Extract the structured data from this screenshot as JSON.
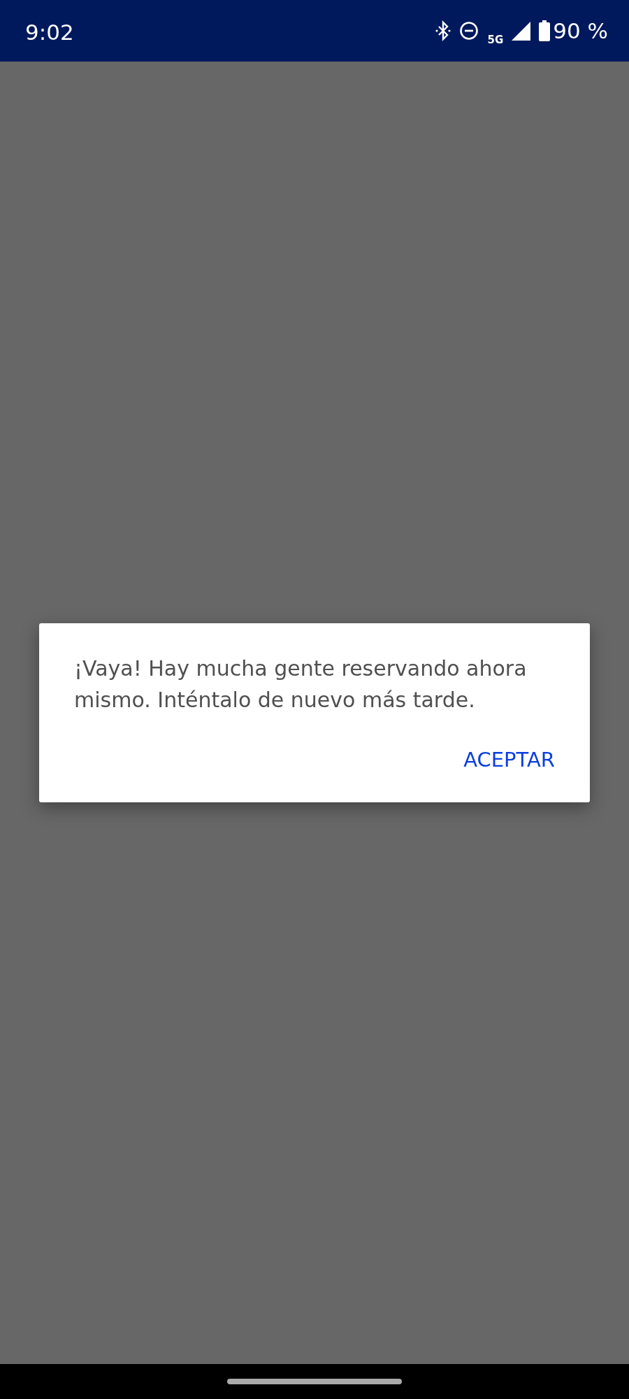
{
  "status_bar": {
    "time": "9:02",
    "network": "5G",
    "battery": "90 %"
  },
  "dialog": {
    "message": "¡Vaya! Hay mucha gente reservando ahora mismo. Inténtalo de nuevo más tarde.",
    "buttons": [
      "ACEPTAR"
    ]
  }
}
